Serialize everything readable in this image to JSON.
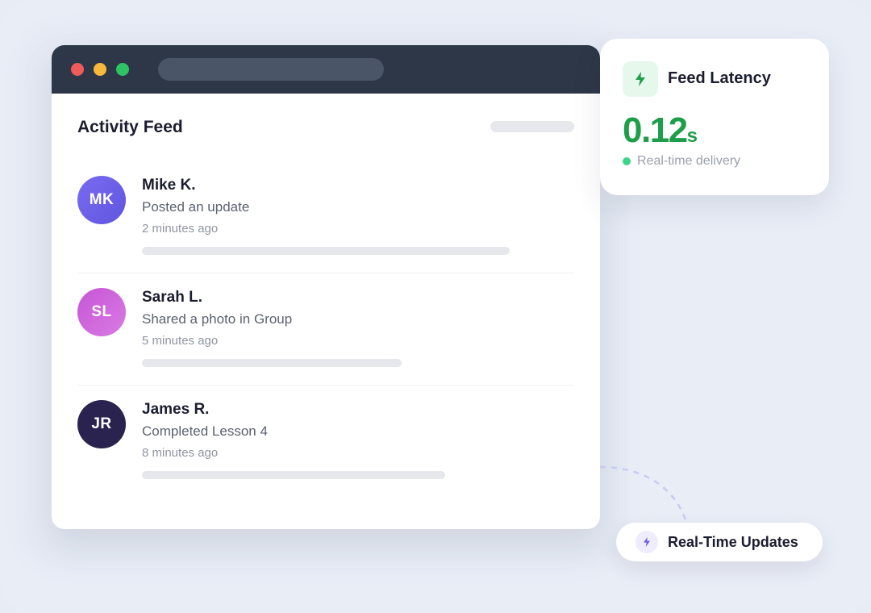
{
  "feed": {
    "title": "Activity Feed",
    "items": [
      {
        "initials": "MK",
        "name": "Mike K.",
        "action": "Posted an update",
        "time": "2 minutes ago"
      },
      {
        "initials": "SL",
        "name": "Sarah L.",
        "action": "Shared a photo in Group",
        "time": "5 minutes ago"
      },
      {
        "initials": "JR",
        "name": "James R.",
        "action": "Completed Lesson 4",
        "time": "8 minutes ago"
      }
    ]
  },
  "latency": {
    "title": "Feed Latency",
    "value": "0.12",
    "unit": "s",
    "status": "Real-time delivery",
    "accent_color": "#1e9e4a",
    "icon": "lightning-icon"
  },
  "badge": {
    "label": "Real-Time Updates",
    "icon": "lightning-icon",
    "accent_color": "#6c5ce7"
  }
}
